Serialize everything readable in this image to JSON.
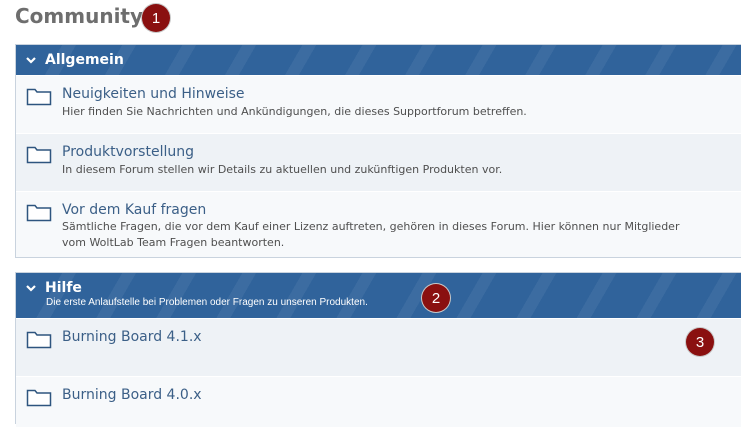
{
  "page": {
    "title": "Community"
  },
  "badges": [
    "1",
    "2",
    "3"
  ],
  "categories": [
    {
      "title": "Allgemein",
      "boards": [
        {
          "title": "Neuigkeiten und Hinweise",
          "description": "Hier finden Sie Nachrichten und Ankündigungen, die dieses Supportforum betreffen."
        },
        {
          "title": "Produktvorstellung",
          "description": "In diesem Forum stellen wir Details zu aktuellen und zukünftigen Produkten vor."
        },
        {
          "title": "Vor dem Kauf fragen",
          "description": "Sämtliche Fragen, die vor dem Kauf einer Lizenz auftreten, gehören in dieses Forum. Hier können nur Mitglieder vom WoltLab Team Fragen beantworten."
        }
      ]
    },
    {
      "title": "Hilfe",
      "description": "Die erste Anlaufstelle bei Problemen oder Fragen zu unseren Produkten.",
      "boards": [
        {
          "title": "Burning Board 4.1.x"
        },
        {
          "title": "Burning Board 4.0.x"
        }
      ]
    }
  ],
  "colors": {
    "header": "#30639b",
    "badge": "#8a1010",
    "link": "#3b5f87"
  },
  "icons": {
    "collapse": "chevron-down-icon",
    "board": "folder-icon"
  }
}
